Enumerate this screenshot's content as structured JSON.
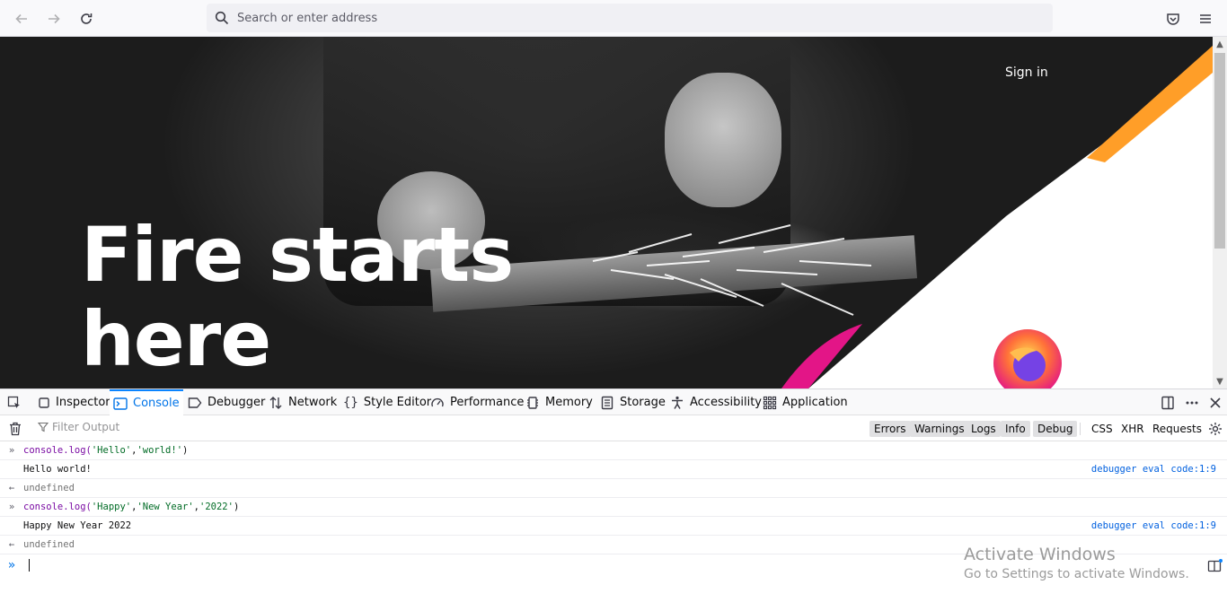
{
  "toolbar": {
    "url_placeholder": "Search or enter address"
  },
  "hero": {
    "title_line1": "Fire starts",
    "title_line2": "here",
    "signin": "Sign in"
  },
  "devtools": {
    "tabs": [
      {
        "label": "Inspector",
        "icon": "inspector-icon"
      },
      {
        "label": "Console",
        "icon": "console-icon",
        "active": true
      },
      {
        "label": "Debugger",
        "icon": "debugger-icon"
      },
      {
        "label": "Network",
        "icon": "network-icon"
      },
      {
        "label": "Style Editor",
        "icon": "style-editor-icon"
      },
      {
        "label": "Performance",
        "icon": "performance-icon"
      },
      {
        "label": "Memory",
        "icon": "memory-icon"
      },
      {
        "label": "Storage",
        "icon": "storage-icon"
      },
      {
        "label": "Accessibility",
        "icon": "accessibility-icon"
      },
      {
        "label": "Application",
        "icon": "application-icon"
      }
    ],
    "filter_placeholder": "Filter Output",
    "filters": {
      "errors": "Errors",
      "warnings": "Warnings",
      "logs": "Logs",
      "info": "Info",
      "debug": "Debug",
      "css": "CSS",
      "xhr": "XHR",
      "requests": "Requests"
    },
    "console": {
      "cmd1": {
        "fn": "console.log(",
        "args": [
          " 'Hello'",
          ", ",
          "'world!'"
        ],
        "close": " )"
      },
      "out1": "Hello world!",
      "src1": "debugger eval code:1:9",
      "res1": "undefined",
      "cmd2": {
        "fn": "console.log(",
        "args": [
          " 'Happy'",
          ",",
          "'New Year'",
          ",",
          "'2022'"
        ],
        "close": " )"
      },
      "out2": "Happy New Year 2022",
      "src2": "debugger eval code:1:9",
      "res2": "undefined"
    }
  },
  "watermark": {
    "line1": "Activate Windows",
    "line2": "Go to Settings to activate Windows."
  },
  "colors": {
    "accent": "#0a84ff",
    "string": "#006b25",
    "link": "#0060df"
  }
}
